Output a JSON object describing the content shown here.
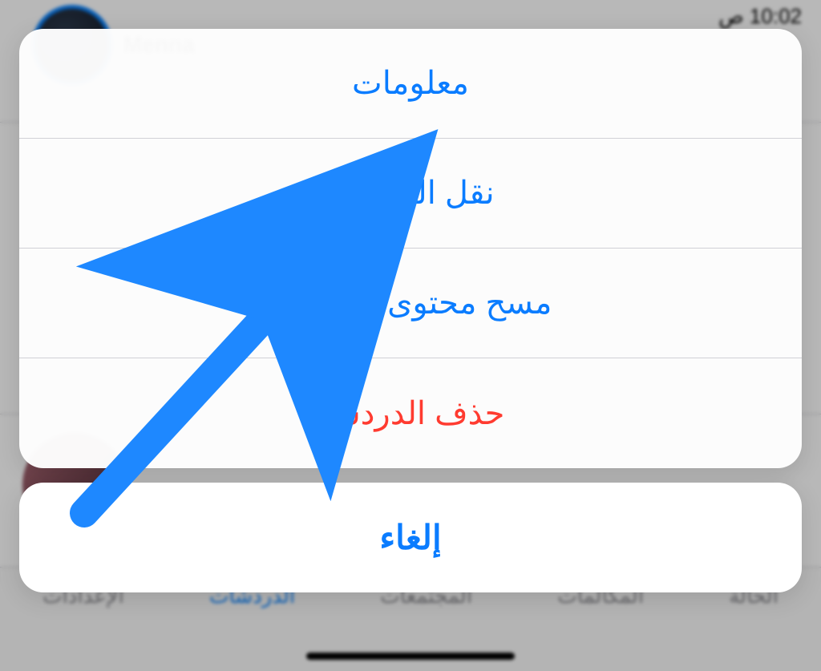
{
  "status": {
    "time": "10:02 ص"
  },
  "header": {
    "contact_name": "Menna"
  },
  "sheet": {
    "info_label": "معلومات",
    "export_label": "نقل الدردشة",
    "clear_label": "مسح محتوى الدردشة",
    "delete_label": "حذف الدردشة",
    "cancel_label": "إلغاء"
  },
  "tabs": {
    "status": "الحالة",
    "calls": "المكالمات",
    "communities": "المجتمعات",
    "chats": "الدردشات",
    "settings": "الإعدادات"
  },
  "annotation": {
    "arrow_color": "#1E88FF"
  }
}
